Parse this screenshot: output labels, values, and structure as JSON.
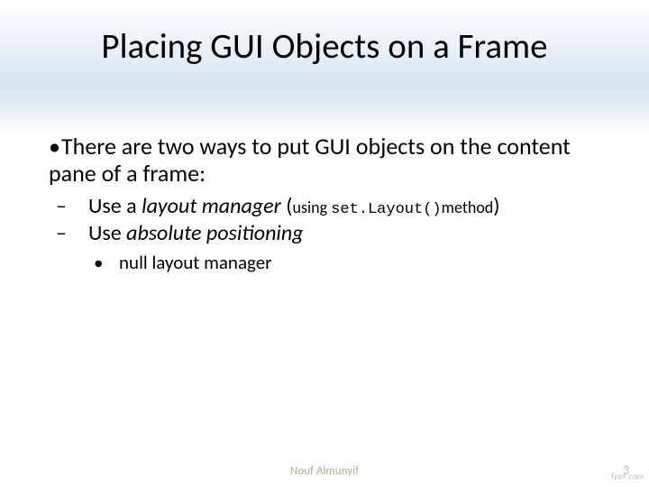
{
  "title": "Placing GUI Objects on a Frame",
  "body": {
    "l1": "There are two ways to put GUI objects on the content pane of a frame:",
    "l2a_prefix": "Use a ",
    "l2a_italic": "layout manager ",
    "l2a_paren_open": "(",
    "l2a_using": "using ",
    "l2a_code": "set.Layout()",
    "l2a_method": "method",
    "l2a_paren_close": ")",
    "l2b_prefix": "Use ",
    "l2b_italic": "absolute positioning",
    "l3": "null layout manager"
  },
  "footer": {
    "center": "Nouf Almunyif",
    "page": "3",
    "watermark": "fppt.com"
  }
}
